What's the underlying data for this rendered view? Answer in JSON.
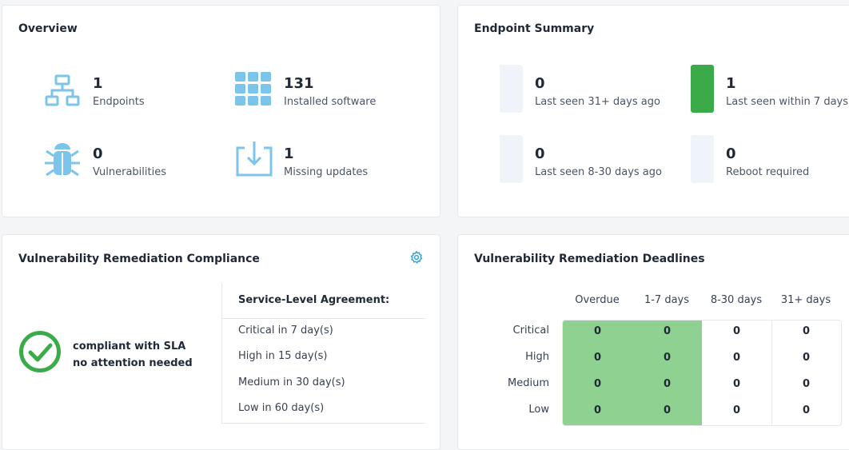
{
  "overview": {
    "title": "Overview",
    "stats": [
      {
        "value": "1",
        "label": "Endpoints",
        "icon": "network-icon"
      },
      {
        "value": "131",
        "label": "Installed software",
        "icon": "grid-apps-icon"
      },
      {
        "value": "0",
        "label": "Vulnerabilities",
        "icon": "bug-icon"
      },
      {
        "value": "1",
        "label": "Missing updates",
        "icon": "download-tray-icon"
      }
    ],
    "icon_color": "#7cc4ea"
  },
  "endpoint_summary": {
    "title": "Endpoint Summary",
    "items": [
      {
        "value": "0",
        "label": "Last seen 31+ days ago",
        "color": "#eef4fa"
      },
      {
        "value": "1",
        "label": "Last seen within 7 days",
        "color": "#3bab4a"
      },
      {
        "value": "0",
        "label": "Last seen 8-30 days ago",
        "color": "#eef4fa"
      },
      {
        "value": "0",
        "label": "Reboot required",
        "color": "#eef4fa"
      }
    ]
  },
  "compliance": {
    "title": "Vulnerability Remediation Compliance",
    "status_line1": "compliant with SLA",
    "status_line2": "no attention needed",
    "status_color": "#3bab4a",
    "sla_heading": "Service-Level Agreement:",
    "sla_rows": [
      "Critical in 7 day(s)",
      "High in 15 day(s)",
      "Medium in 30 day(s)",
      "Low in 60 day(s)"
    ],
    "settings_icon": "gear-icon"
  },
  "deadlines": {
    "title": "Vulnerability Remediation Deadlines",
    "columns": [
      "Overdue",
      "1-7 days",
      "8-30 days",
      "31+ days"
    ],
    "rows": [
      "Critical",
      "High",
      "Medium",
      "Low"
    ],
    "cells": [
      [
        "0",
        "0",
        "0",
        "0"
      ],
      [
        "0",
        "0",
        "0",
        "0"
      ],
      [
        "0",
        "0",
        "0",
        "0"
      ],
      [
        "0",
        "0",
        "0",
        "0"
      ]
    ],
    "highlight_color": "#8fd191"
  }
}
